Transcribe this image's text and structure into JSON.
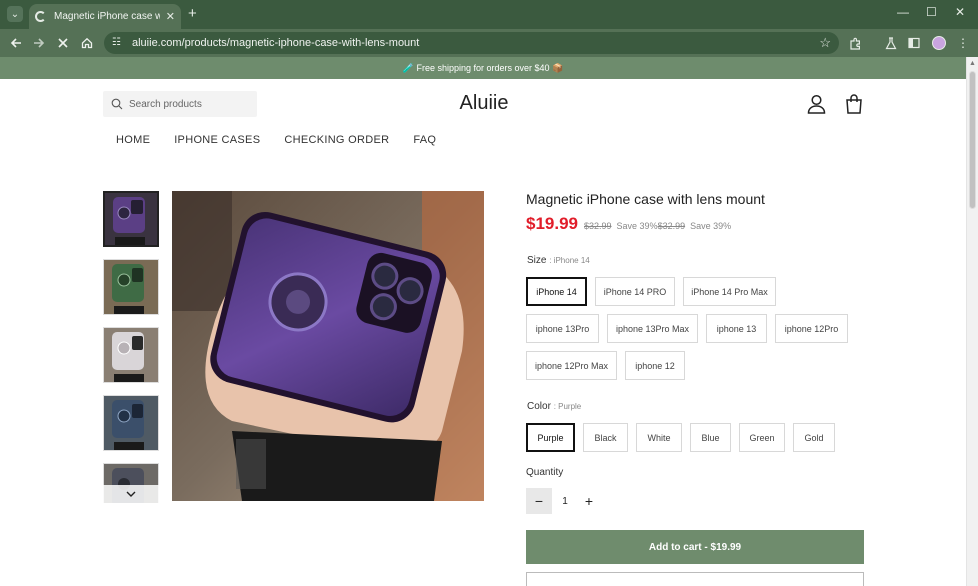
{
  "browser": {
    "tab_title": "Magnetic iPhone case with lens mount",
    "url": "aluiie.com/products/magnetic-iphone-case-with-lens-mount",
    "new_tab": "+",
    "tab_close": "✕"
  },
  "announcement": "🧪 Free shipping for orders over $40 📦",
  "header": {
    "search_placeholder": "Search products",
    "logo": "Aluiie"
  },
  "nav": [
    "HOME",
    "IPHONE CASES",
    "CHECKING ORDER",
    "FAQ"
  ],
  "product": {
    "title": "Magnetic iPhone case with lens mount",
    "price": "$19.99",
    "compare_price": "$32.99",
    "save_text": "Save 39%",
    "compare_price_2": "$32.99",
    "save_text_2": "Save 39%",
    "size_label": "Size",
    "size_selected": ": iPhone 14",
    "sizes": [
      "iPhone 14",
      "iPhone 14 PRO",
      "iPhone 14 Pro Max",
      "iphone 13Pro",
      "iphone 13Pro Max",
      "iphone 13",
      "iphone 12Pro",
      "iphone 12Pro Max",
      "iphone 12"
    ],
    "color_label": "Color",
    "color_selected": ": Purple",
    "colors": [
      "Purple",
      "Black",
      "White",
      "Blue",
      "Green",
      "Gold"
    ],
    "quantity_label": "Quantity",
    "quantity": "1",
    "qty_minus": "−",
    "qty_plus": "+",
    "add_to_cart": "Add to cart  -  $19.99"
  },
  "colors": {
    "chrome_dark": "#3b5a3f",
    "chrome_light": "#557156",
    "brand_green": "#6f8c6d",
    "price_red": "#e11d2a"
  }
}
